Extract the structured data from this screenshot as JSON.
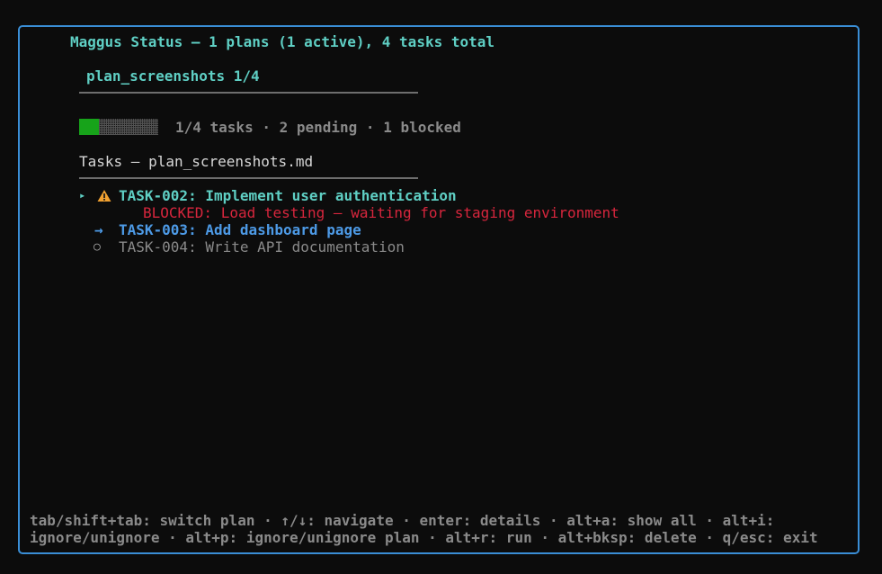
{
  "header": {
    "title": "Maggus Status — 1 plans (1 active), 4 tasks total"
  },
  "plan_tab": {
    "label": "plan_screenshots 1/4"
  },
  "progress": {
    "completed": 1,
    "total": 4,
    "fraction": 0.25,
    "summary": "1/4 tasks · 2 pending · 1 blocked",
    "fill_color": "#17a31a"
  },
  "tasks": {
    "heading": "Tasks — plan_screenshots.md",
    "items": [
      {
        "selector": "▸",
        "icon": "warning-icon",
        "label": "TASK-002: Implement user authentication",
        "blocked_note": "BLOCKED: Load testing — waiting for staging environment",
        "color": "#5fcfc4"
      },
      {
        "marker": "→",
        "label": "TASK-003: Add dashboard page",
        "color": "#4d9ae6"
      },
      {
        "marker": "○",
        "label": "TASK-004: Write API documentation",
        "color": "#8a8a8a"
      }
    ]
  },
  "help": {
    "line1": "tab/shift+tab: switch plan · ↑/↓: navigate · enter: details · alt+a: show all · alt+i:",
    "line2": "ignore/unignore · alt+p: ignore/unignore plan · alt+r: run · alt+bksp: delete · q/esc: exit"
  },
  "colors": {
    "border": "#3a8ed6",
    "accent": "#5fcfc4",
    "blocked": "#d7263d",
    "warning": "#f0a030"
  }
}
